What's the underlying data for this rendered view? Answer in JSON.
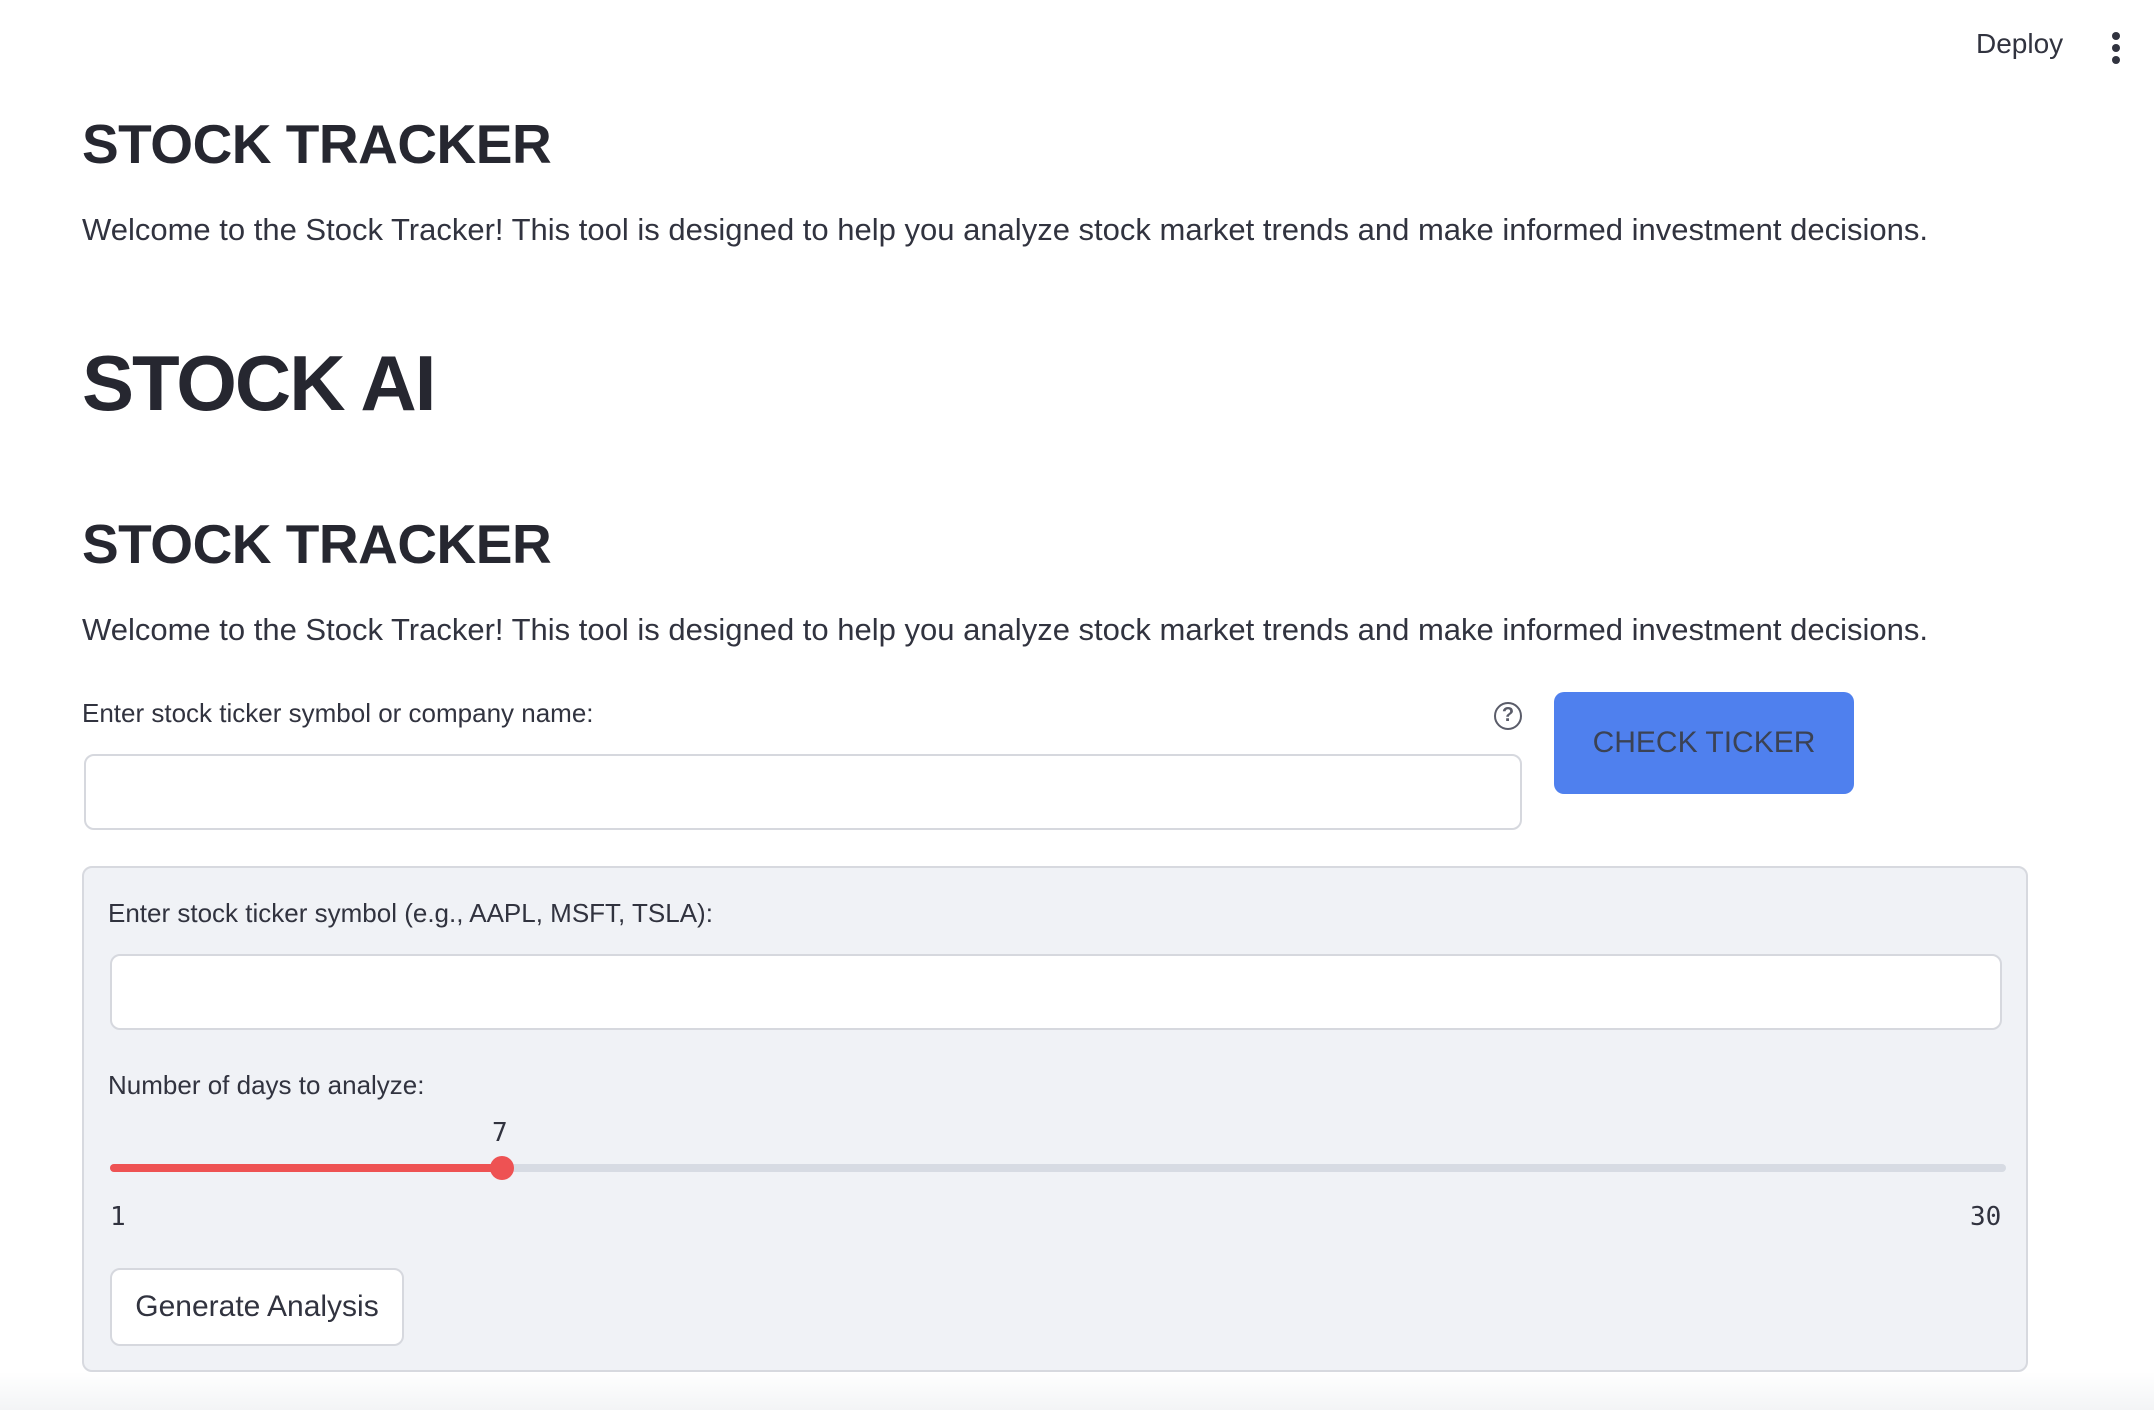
{
  "topbar": {
    "deploy_label": "Deploy",
    "menu_icon": "vertical-ellipsis-icon"
  },
  "section1": {
    "title": "STOCK TRACKER",
    "description": "Welcome to the Stock Tracker! This tool is designed to help you analyze stock market trends and make informed investment decisions."
  },
  "app_title": "STOCK AI",
  "section2": {
    "title": "STOCK TRACKER",
    "description": "Welcome to the Stock Tracker! This tool is designed to help you analyze stock market trends and make informed investment decisions."
  },
  "search": {
    "label": "Enter stock ticker symbol or company name:",
    "help_icon": "question-circle-icon",
    "value": "",
    "check_button": "CHECK TICKER"
  },
  "form": {
    "ticker_label": "Enter stock ticker symbol (e.g., AAPL, MSFT, TSLA):",
    "ticker_value": "",
    "days_label": "Number of days to analyze:",
    "days_value": "7",
    "days_min": "1",
    "days_max": "30",
    "generate_button": "Generate Analysis"
  },
  "colors": {
    "primary_button": "#4f80ee",
    "slider_accent": "#ee5253",
    "form_background": "#f0f2f6"
  }
}
